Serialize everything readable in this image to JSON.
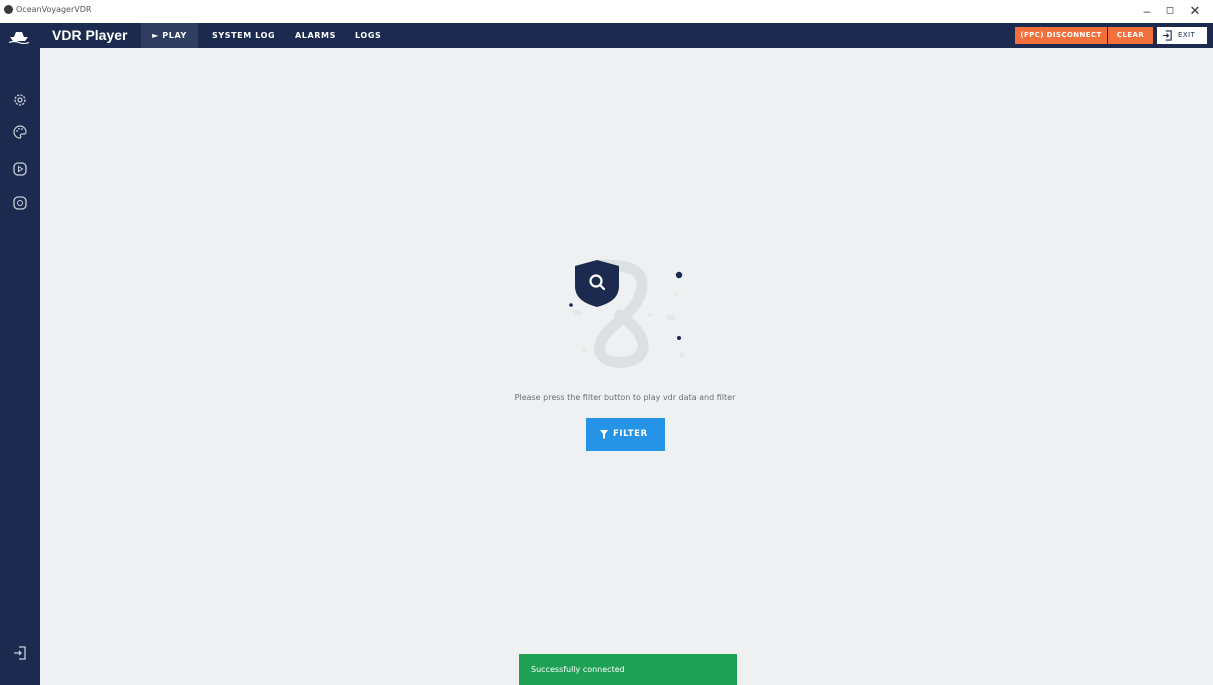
{
  "window": {
    "title": "OceanVoyagerVDR",
    "minimize": "–",
    "maximize": "◻",
    "close": "✕"
  },
  "header": {
    "app_title": "VDR Player",
    "tabs": [
      {
        "label": "► PLAY",
        "active": true
      },
      {
        "label": "SYSTEM LOG",
        "active": false
      },
      {
        "label": "ALARMS",
        "active": false
      },
      {
        "label": "LOGS",
        "active": false
      }
    ],
    "disconnect_label": "(FPC) DISCONNECT",
    "clear_label": "CLEAR",
    "exit_label": "EXIT"
  },
  "sidebar": {
    "icons": [
      "settings-icon",
      "palette-icon",
      "play-circle-icon",
      "play-circle-outline-icon"
    ],
    "bottom_icon": "login-icon"
  },
  "empty_state": {
    "message": "Please press the filter button to play vdr data and filter",
    "filter_label": "FILTER"
  },
  "toast": {
    "message": "Successfully connected"
  },
  "colors": {
    "header_bg": "#1b2a4e",
    "accent_orange": "#f36f3c",
    "primary_blue": "#2593e6",
    "success_green": "#1ea055",
    "page_bg": "#eef0f1"
  }
}
